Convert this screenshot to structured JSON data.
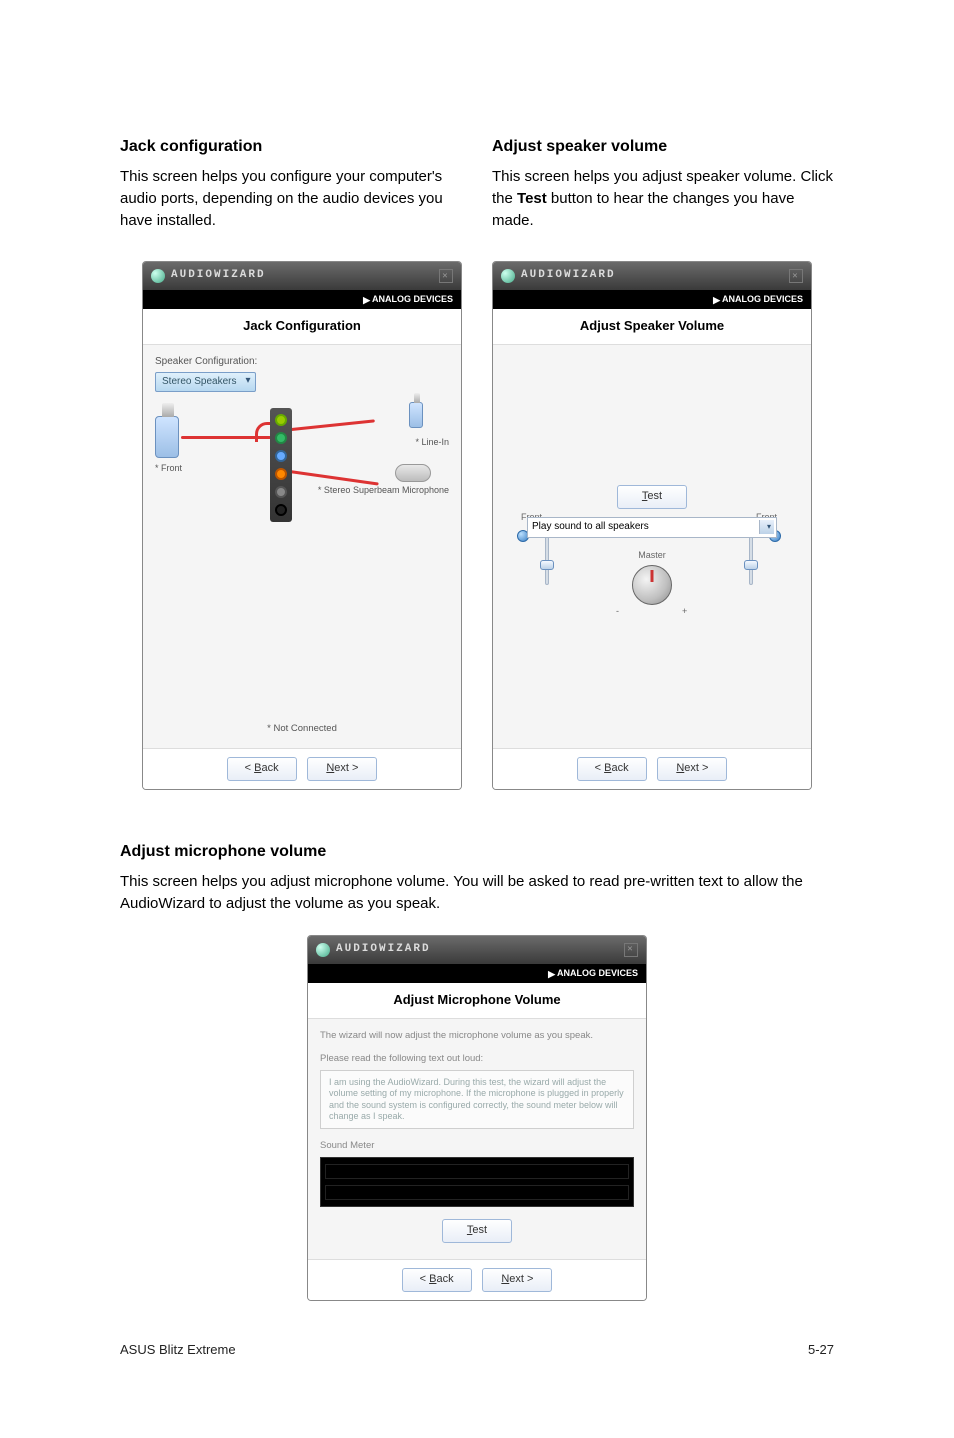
{
  "sections": {
    "jack": {
      "heading": "Jack configuration",
      "body": "This screen helps you configure your computer's audio ports, depending on the audio devices you have installed."
    },
    "speaker": {
      "heading": "Adjust speaker volume",
      "body_pre": "This screen helps you adjust speaker volume. Click the ",
      "body_bold": "Test",
      "body_post": " button to hear the changes you have made."
    },
    "mic": {
      "heading": "Adjust microphone volume",
      "body": "This screen helps you adjust microphone volume. You will be asked to read pre-written text to allow the AudioWizard to adjust the volume as you speak."
    }
  },
  "wizard": {
    "app_title": "AUDIOWIZARD",
    "brand": "ANALOG DEVICES",
    "back_label_prefix": "< ",
    "back_u": "B",
    "back_rest": "ack",
    "next_u": "N",
    "next_rest": "ext >",
    "test_u": "T",
    "test_rest": "est"
  },
  "jack_card": {
    "title": "Jack Configuration",
    "config_label": "Speaker Configuration:",
    "config_value": "Stereo Speakers",
    "front_label": "* Front",
    "linein_label": "* Line-In",
    "mic_label": "* Stereo Superbeam Microphone",
    "not_connected": "* Not Connected"
  },
  "speaker_card": {
    "title": "Adjust Speaker Volume",
    "front_left": "Front",
    "front_right": "Front",
    "master": "Master",
    "minus": "-",
    "plus": "+",
    "play_to": "Play sound to all speakers"
  },
  "mic_card": {
    "title": "Adjust Microphone Volume",
    "desc": "The wizard will now adjust the microphone volume as you speak.",
    "read_label": "Please read the following text out loud:",
    "read_text": "I am using the AudioWizard. During this test, the wizard will adjust the volume setting of my microphone. If the microphone is plugged in properly and the sound system is configured correctly, the sound meter below will change as I speak.",
    "meter_label": "Sound Meter"
  },
  "footer": {
    "left": "ASUS Blitz Extreme",
    "right": "5-27"
  }
}
